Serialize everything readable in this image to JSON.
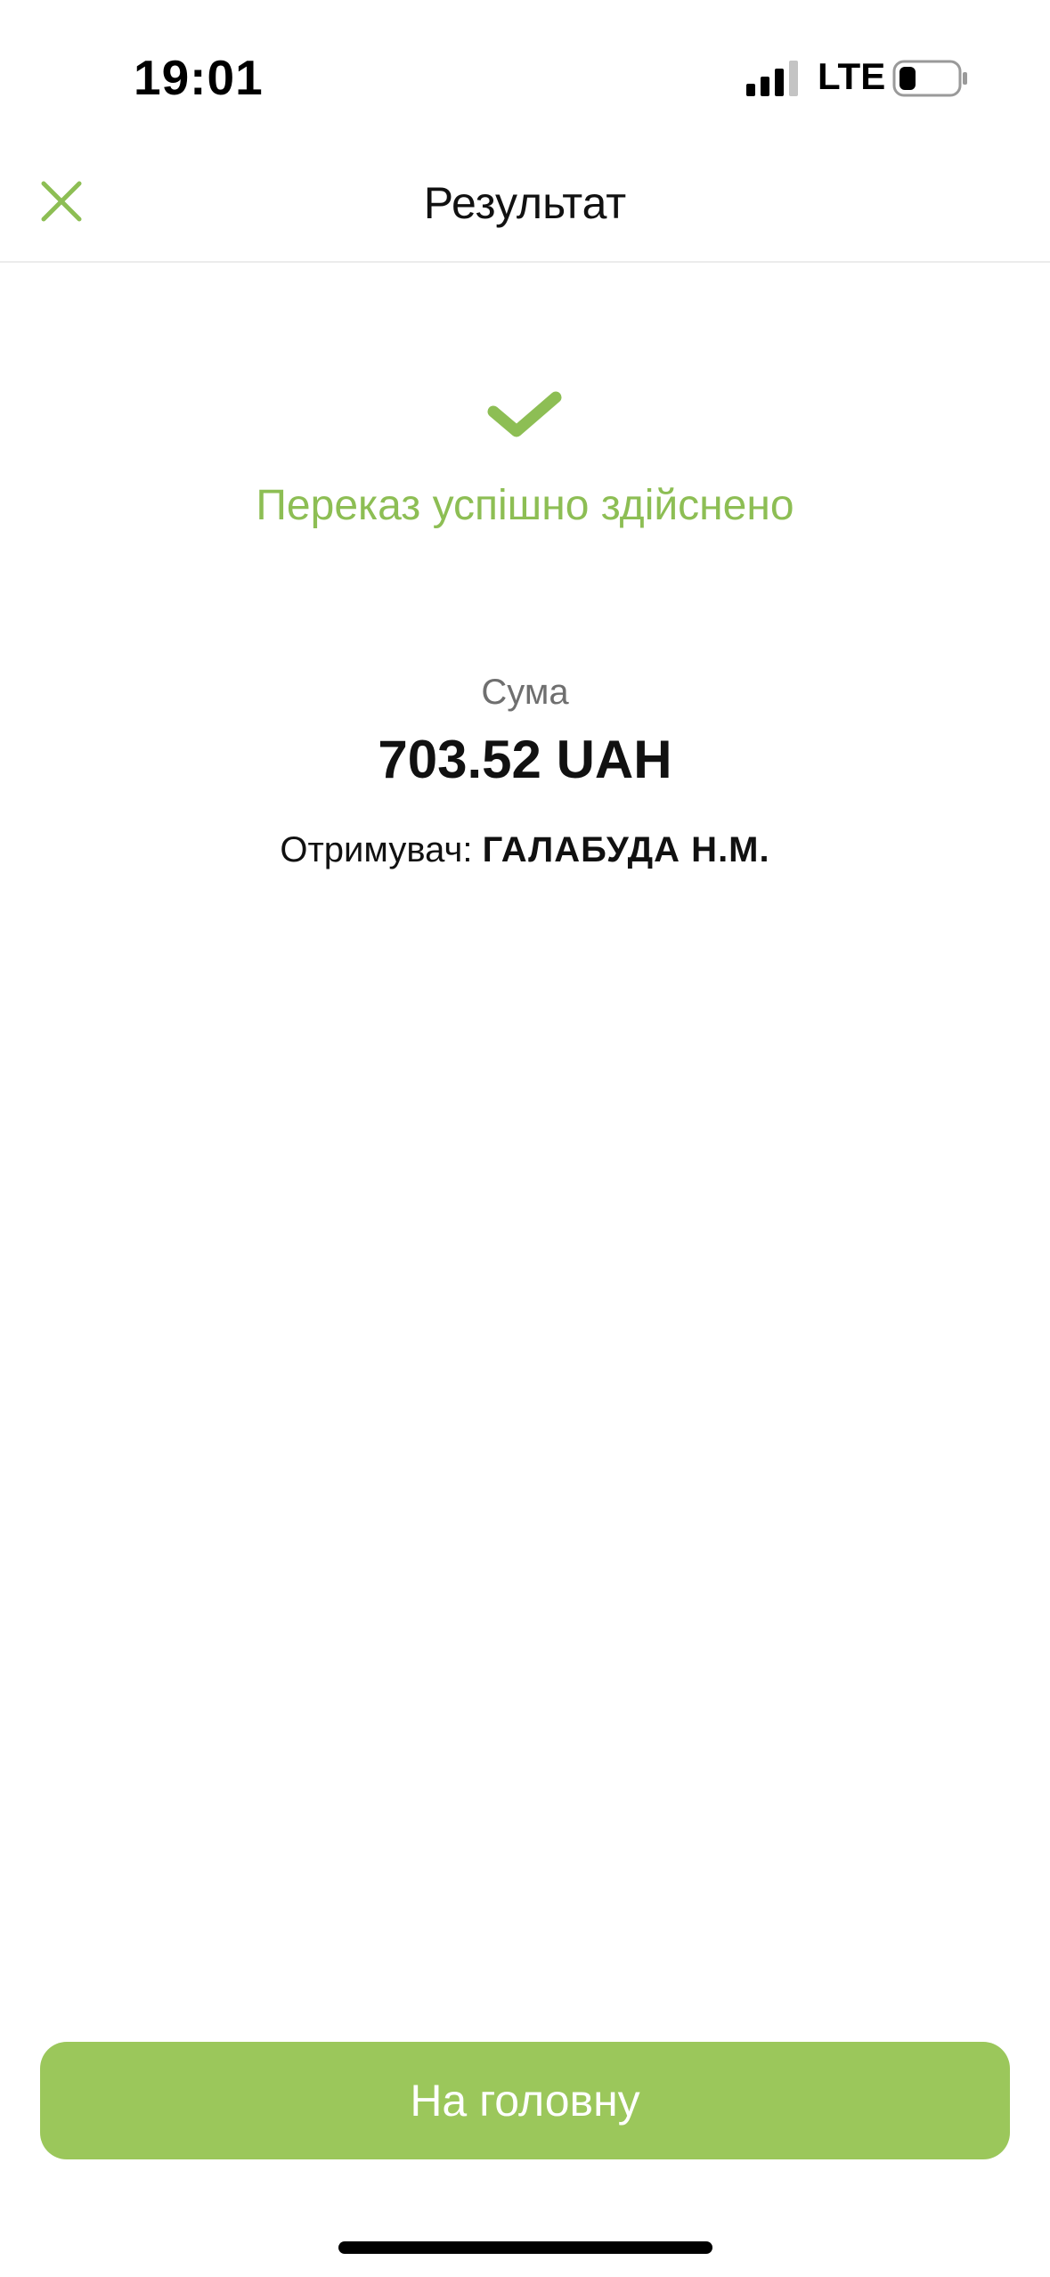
{
  "status_bar": {
    "time": "19:01",
    "network": "LTE",
    "signal_icon": "cellular-signal-icon",
    "battery_icon": "battery-icon"
  },
  "header": {
    "title": "Результат",
    "close_icon": "close-icon"
  },
  "result": {
    "check_icon": "checkmark-icon",
    "message": "Переказ успішно здійснено",
    "amount_label": "Сума",
    "amount_value": "703.52 UAH",
    "recipient_label": "Отримувач:",
    "recipient_name": "ГАЛАБУДА Н.М."
  },
  "actions": {
    "home_label": "На головну"
  },
  "colors": {
    "accent": "#9bc75b",
    "success_text": "#8dbe54"
  }
}
